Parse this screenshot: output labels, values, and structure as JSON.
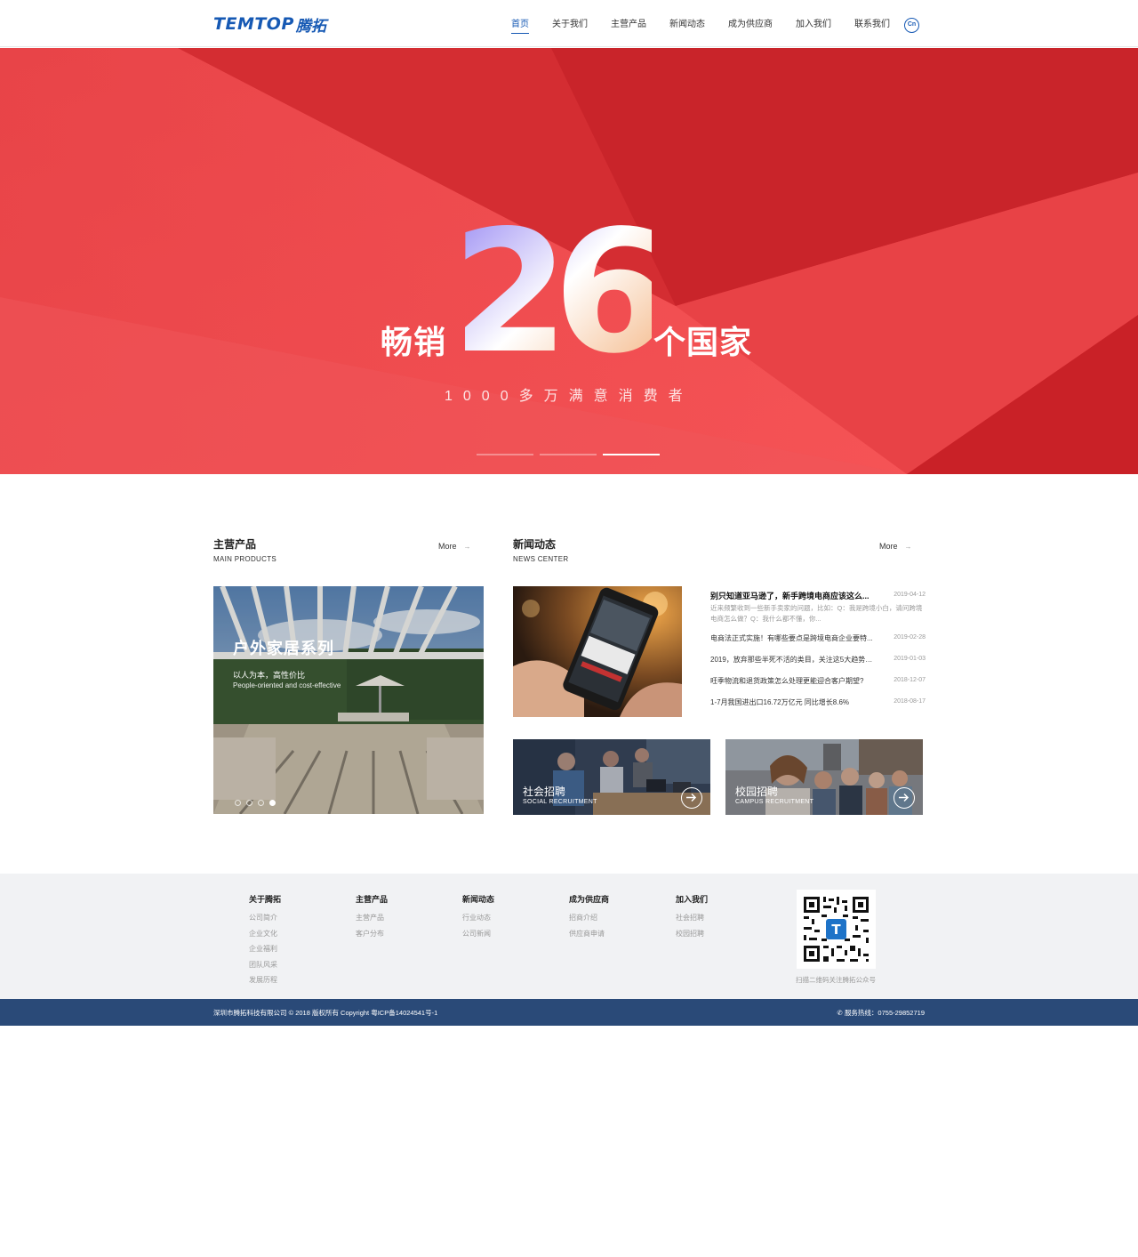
{
  "header": {
    "logo_en": "TEMTOP",
    "logo_cn": "腾拓",
    "nav": [
      "首页",
      "关于我们",
      "主营产品",
      "新闻动态",
      "成为供应商",
      "加入我们",
      "联系我们"
    ],
    "lang": "Cn"
  },
  "banner": {
    "left_text": "畅销",
    "number": "26",
    "right_text": "个国家",
    "subtitle": "1000多万满意消费者",
    "active_slide": 3,
    "slide_count": 3,
    "colors": {
      "base": "#e03b3e",
      "dark": "#b81d22",
      "light": "#f05456"
    }
  },
  "products": {
    "title": "主营产品",
    "subtitle": "MAIN PRODUCTS",
    "more": "More",
    "slide_title": "户外家居系列",
    "slide_desc": "以人为本，高性价比",
    "slide_desc_en": "People-oriented and cost-effective",
    "slide_count": 4,
    "active_slide": 4
  },
  "news": {
    "title": "新闻动态",
    "subtitle": "NEWS CENTER",
    "more": "More",
    "items": [
      {
        "title": "别只知道亚马逊了，新手跨境电商应该这么...",
        "date": "2019-04-12",
        "summary": "近来频繁收到一些新手卖家的问题，比如：Q：我是跨境小白，请问跨境电商怎么做？Q：我什么都不懂，你..."
      },
      {
        "title": "电商法正式实施！有哪些要点是跨境电商企业要特...",
        "date": "2019-02-28"
      },
      {
        "title": "2019，放弃那些半死不活的类目，关注这5大趋势类...",
        "date": "2019-01-03"
      },
      {
        "title": "旺季物流和退货政策怎么处理更能迎合客户期望?",
        "date": "2018-12-07"
      },
      {
        "title": "1-7月我国进出口16.72万亿元 同比增长8.6%",
        "date": "2018-08-17"
      }
    ]
  },
  "recruit": {
    "social": {
      "title": "社会招聘",
      "subtitle": "SOCIAL RECRUITMENT"
    },
    "campus": {
      "title": "校园招聘",
      "subtitle": "CAMPUS RECRUITMENT"
    }
  },
  "footer": {
    "columns": [
      {
        "head": "关于腾拓",
        "items": [
          "公司简介",
          "企业文化",
          "企业福利",
          "团队风采",
          "发展历程"
        ]
      },
      {
        "head": "主营产品",
        "items": [
          "主营产品",
          "客户分布"
        ]
      },
      {
        "head": "新闻动态",
        "items": [
          "行业动态",
          "公司新闻"
        ]
      },
      {
        "head": "成为供应商",
        "items": [
          "招商介绍",
          "供应商申请"
        ]
      },
      {
        "head": "加入我们",
        "items": [
          "社会招聘",
          "校园招聘"
        ]
      }
    ],
    "qr_caption": "扫描二维码关注腾拓公众号",
    "qr_logo": "T",
    "copyright": "深圳市腾拓科技有限公司 © 2018 版权所有 Copyright    粤ICP备14024541号-1",
    "hotline": "服务热线：0755-29852719",
    "hotline_icon": "phone-icon"
  }
}
